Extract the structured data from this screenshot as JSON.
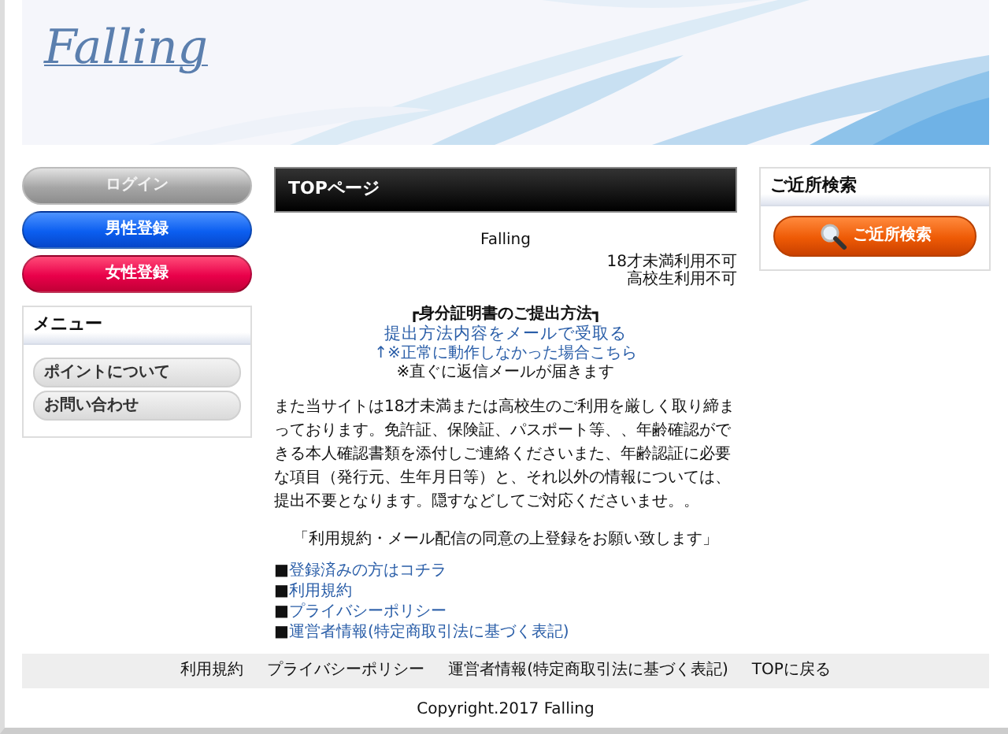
{
  "header": {
    "logo": "Falling"
  },
  "sidebar": {
    "buttons": [
      {
        "label": "ログイン",
        "kind": "login"
      },
      {
        "label": "男性登録",
        "kind": "male"
      },
      {
        "label": "女性登録",
        "kind": "female"
      }
    ],
    "menu": {
      "title": "メニュー",
      "items": [
        "ポイントについて",
        "お問い合わせ"
      ]
    }
  },
  "main": {
    "title": "TOPページ",
    "site_name": "Falling",
    "notices": [
      "18才未満利用不可",
      "高校生利用不可"
    ],
    "id_heading": "┏身分証明書のご提出方法┓",
    "id_link": "提出方法内容をメールで受取る",
    "fallback_link": "↑※正常に動作しなかった場合こちら",
    "note": "※直ぐに返信メールが届きます",
    "paragraph": "また当サイトは18才未満または高校生のご利用を厳しく取り締まっております。免許証、保険証、パスポート等、、年齢確認ができる本人確認書類を添付しご連絡くださいまた、年齢認証に必要な項目（発行元、生年月日等）と、それ以外の情報については、提出不要となります。隠すなどしてご対応くださいませ。。",
    "agreement": "「利用規約・メール配信の同意の上登録をお願い致します」",
    "links": [
      {
        "bullet": "■",
        "label": "登録済みの方はコチラ"
      },
      {
        "bullet": "■",
        "label": "利用規約"
      },
      {
        "bullet": "■",
        "label": "プライバシーポリシー"
      },
      {
        "bullet": "■",
        "label": "運営者情報(特定商取引法に基づく表記)"
      }
    ]
  },
  "search": {
    "title": "ご近所検索",
    "button": "ご近所検索"
  },
  "footer": {
    "links": [
      "利用規約",
      "プライバシーポリシー",
      "運営者情報(特定商取引法に基づく表記)",
      "TOPに戻る"
    ],
    "copyright": "Copyright.2017 Falling"
  }
}
